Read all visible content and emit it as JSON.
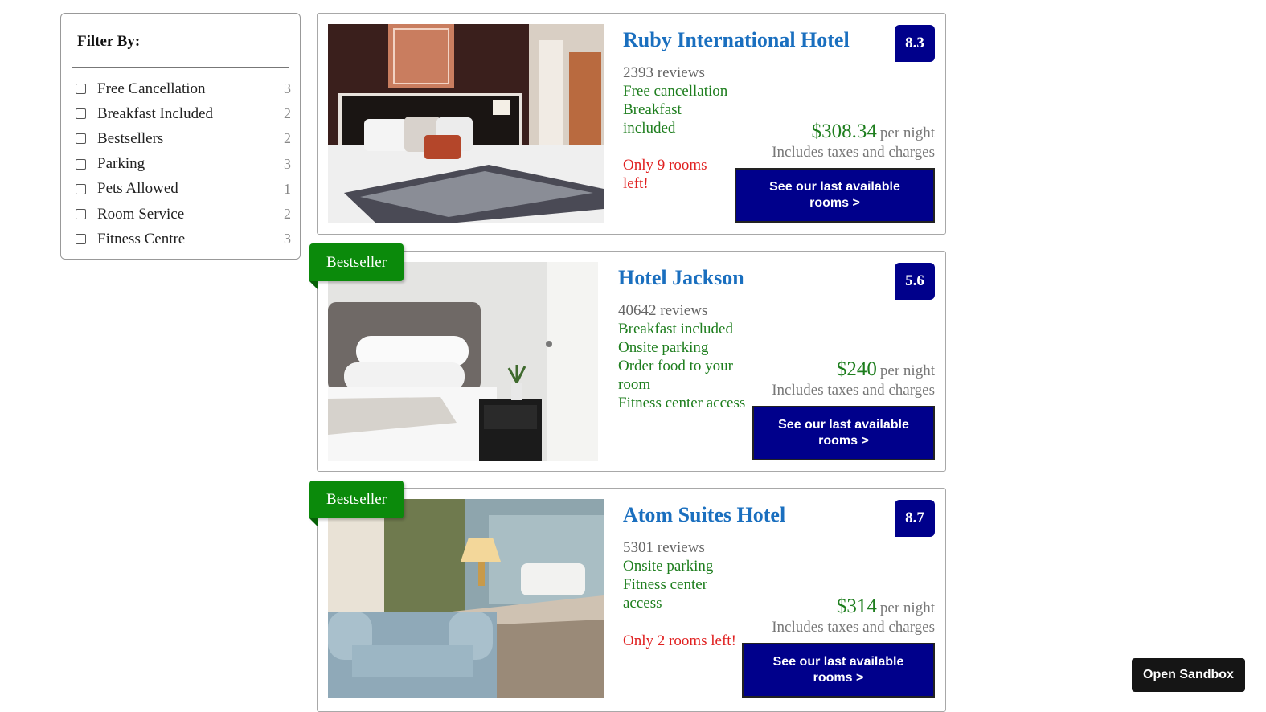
{
  "filter": {
    "title": "Filter By:",
    "items": [
      {
        "label": "Free Cancellation",
        "count": "3"
      },
      {
        "label": "Breakfast Included",
        "count": "2"
      },
      {
        "label": "Bestsellers",
        "count": "2"
      },
      {
        "label": "Parking",
        "count": "3"
      },
      {
        "label": "Pets Allowed",
        "count": "1"
      },
      {
        "label": "Room Service",
        "count": "2"
      },
      {
        "label": "Fitness Centre",
        "count": "3"
      }
    ]
  },
  "hotels": [
    {
      "name": "Ruby International Hotel",
      "score": "8.3",
      "reviews": "2393 reviews",
      "features": [
        "Free cancellation",
        "Breakfast",
        "included"
      ],
      "scarcity": [
        "Only 9 rooms",
        "left!"
      ],
      "price": "$308.34",
      "per_night": "per night",
      "taxes": "Includes taxes and charges",
      "cta": [
        "See our last available",
        "rooms >"
      ]
    },
    {
      "name": "Hotel Jackson",
      "score": "5.6",
      "badge": "Bestseller",
      "reviews": "40642 reviews",
      "features": [
        "Breakfast included",
        "Onsite parking",
        "Order food to your",
        "room",
        "Fitness center access"
      ],
      "price": "$240",
      "per_night": "per night",
      "taxes": "Includes taxes and charges",
      "cta": [
        "See our last available",
        "rooms >"
      ]
    },
    {
      "name": "Atom Suites Hotel",
      "score": "8.7",
      "badge": "Bestseller",
      "reviews": "5301 reviews",
      "features": [
        "Onsite parking",
        "Fitness center",
        "access"
      ],
      "scarcity": [
        "Only 2 rooms left!"
      ],
      "price": "$314",
      "per_night": "per night",
      "taxes": "Includes taxes and charges",
      "cta": [
        "See our last available",
        "rooms >"
      ]
    }
  ],
  "sandbox_button": "Open Sandbox",
  "colors": {
    "score_bg": "#00008b",
    "hotel_name": "#1a6fbf",
    "feature_green": "#1e7e1e",
    "scarcity_red": "#e02020",
    "bestseller_green": "#0b8a0b"
  }
}
